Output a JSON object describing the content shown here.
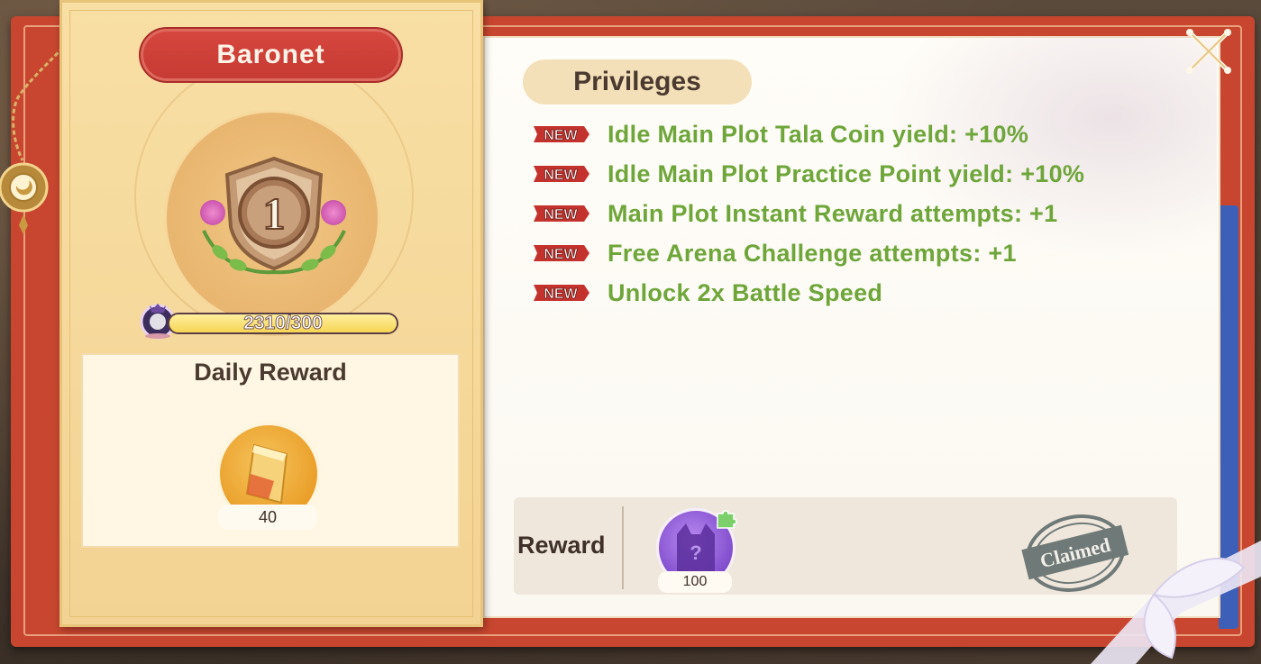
{
  "rank": {
    "title": "Baronet",
    "level": "1",
    "progress_text": "2310/300",
    "progress_fraction": 1.0
  },
  "daily_reward": {
    "title": "Daily Reward",
    "item_icon": "gold-ingot-icon",
    "count": "40"
  },
  "privileges": {
    "title": "Privileges",
    "new_tag": "NEW",
    "items": [
      {
        "text": "Idle Main Plot Tala Coin yield: +10%"
      },
      {
        "text": "Idle Main Plot Practice Point yield: +10%"
      },
      {
        "text": "Main Plot Instant Reward attempts: +1"
      },
      {
        "text": "Free Arena Challenge attempts: +1"
      },
      {
        "text": "Unlock 2x Battle Speed"
      }
    ]
  },
  "reward": {
    "label": "Reward",
    "item_icon": "mystery-cat-avatar-icon",
    "count": "100",
    "status": "Claimed"
  },
  "colors": {
    "frame_red": "#c8462f",
    "privilege_green": "#6ea63a",
    "banner_red": "#d6473f",
    "card_gold": "#f3d393"
  }
}
